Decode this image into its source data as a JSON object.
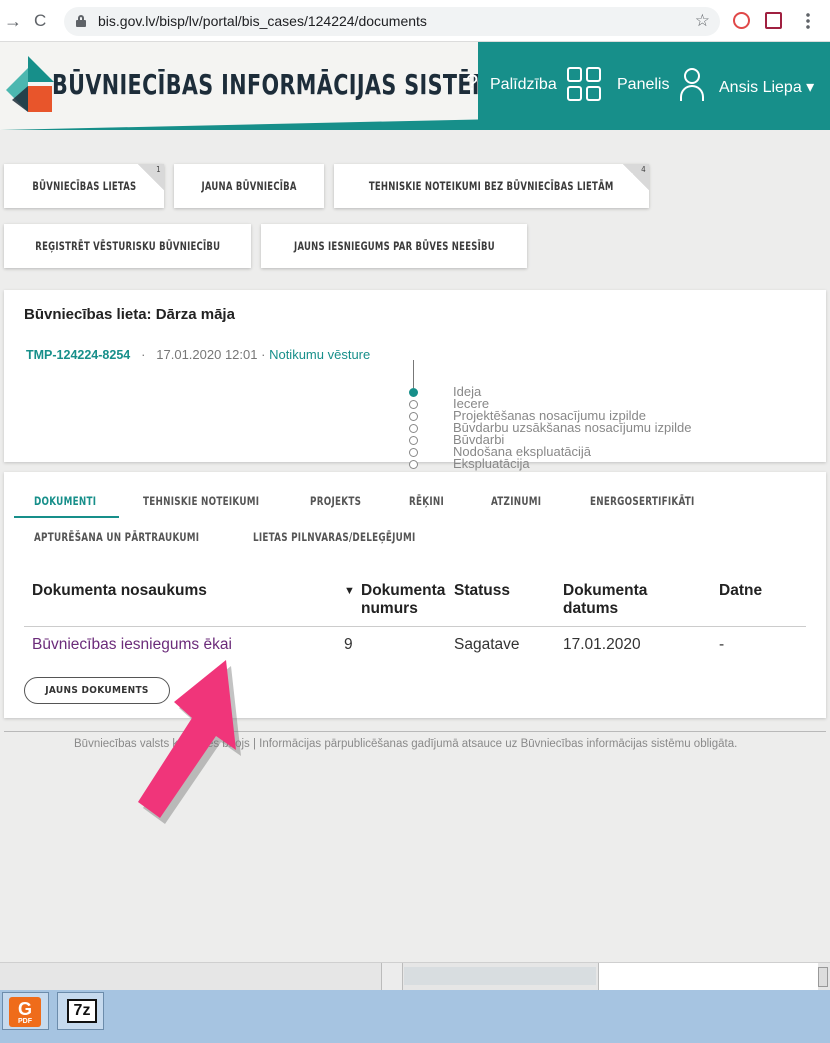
{
  "browser": {
    "back_glyph": "→",
    "reload_glyph": "C",
    "url": "bis.gov.lv/bisp/lv/portal/bis_cases/124224/documents",
    "star_glyph": "☆"
  },
  "header": {
    "title": "BŪVNIECĪBAS INFORMĀCIJAS SISTĒMA",
    "help_label": "Palīdzība",
    "help_glyph": "?",
    "dashboard_label": "Panelis",
    "user_name": "Ansis Liepa ▾",
    "brand_colors": {
      "teal": "#178f8a",
      "orange": "#e8552b"
    }
  },
  "tiles": [
    {
      "label": "BŪVNIECĪBAS LIETAS",
      "count": "1"
    },
    {
      "label": "JAUNA BŪVNIECĪBA"
    },
    {
      "label": "TEHNISKIE NOTEIKUMI BEZ BŪVNIECĪBAS LIETĀM",
      "count": "4"
    },
    {
      "label": "REĢISTRĒT VĒSTURISKU BŪVNIECĪBU"
    },
    {
      "label": "JAUNS IESNIEGUMS PAR BŪVES NEESĪBU"
    }
  ],
  "case": {
    "title": "Būvniecības lieta: Dārza māja",
    "id": "TMP-124224-8254",
    "separator": "·",
    "datetime": "17.01.2020 12:01",
    "history_link": "Notikumu vēsture",
    "stages": [
      "Ideja",
      "Iecere",
      "Projektēšanas nosacījumu izpilde",
      "Būvdarbu uzsākšanas nosacījumu izpilde",
      "Būvdarbi",
      "Nodošana ekspluatācijā",
      "Ekspluatācija"
    ],
    "active_stage": "Ideja"
  },
  "tabs": [
    {
      "label": "DOKUMENTI",
      "active": true
    },
    {
      "label": "TEHNISKIE NOTEIKUMI"
    },
    {
      "label": "PROJEKTS"
    },
    {
      "label": "RĒĶINI"
    },
    {
      "label": "ATZINUMI"
    },
    {
      "label": "ENERGOSERTIFIKĀTI"
    },
    {
      "label": "APTURĒŠANA UN PĀRTRAUKUMI"
    },
    {
      "label": "LIETAS PILNVARAS/DELEĢĒJUMI"
    }
  ],
  "table": {
    "columns": [
      {
        "label": "Dokumenta nosaukums"
      },
      {
        "label": "Dokumenta numurs",
        "sort_glyph": "▼"
      },
      {
        "label": "Statuss"
      },
      {
        "label": "Dokumenta datums"
      },
      {
        "label": "Datne"
      }
    ],
    "rows": [
      {
        "name": "Būvniecības iesniegums ēkai",
        "number": "9",
        "status": "Sagatave",
        "date": "17.01.2020",
        "file": "-"
      }
    ]
  },
  "new_document_button": "JAUNS DOKUMENTS",
  "footer": "Būvniecības valsts kontroles birojs | Informācijas pārpublicēšanas gadījumā atsauce uz Būvniecības informācijas sistēmu obligāta.",
  "annotation": {
    "arrow_color": "#f0357a"
  },
  "taskbar": {
    "pdf_icon_glyph": "G",
    "pdf_icon_caption": "PDF",
    "zip_icon_label": "7z"
  }
}
